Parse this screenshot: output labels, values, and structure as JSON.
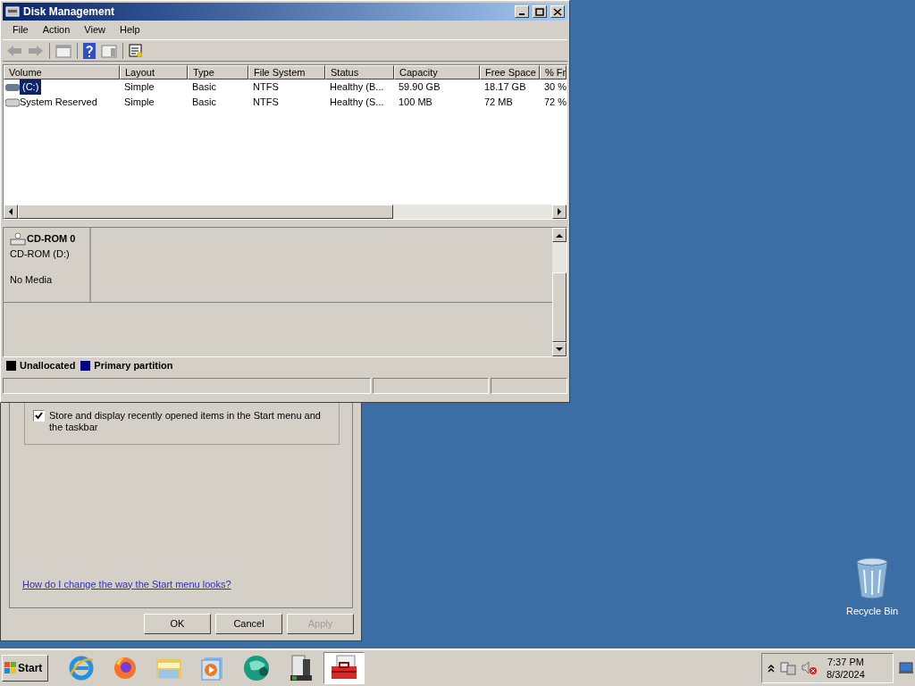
{
  "window": {
    "title": "Disk Management"
  },
  "menu": [
    "File",
    "Action",
    "View",
    "Help"
  ],
  "table": {
    "columns": [
      "Volume",
      "Layout",
      "Type",
      "File System",
      "Status",
      "Capacity",
      "Free Space",
      "% Fr"
    ],
    "rows": [
      {
        "kind": "disk",
        "selected": true,
        "cells": [
          "(C:)",
          "Simple",
          "Basic",
          "NTFS",
          "Healthy (B...",
          "59.90 GB",
          "18.17 GB",
          "30 %"
        ]
      },
      {
        "kind": "reserved",
        "selected": false,
        "cells": [
          "System Reserved",
          "Simple",
          "Basic",
          "NTFS",
          "Healthy (S...",
          "100 MB",
          "72 MB",
          "72 %"
        ]
      }
    ]
  },
  "disks": [
    {
      "name": "CD-ROM 0",
      "volume": "CD-ROM (D:)",
      "status": "No Media"
    }
  ],
  "legend": [
    {
      "label": "Unallocated",
      "color": "#000000"
    },
    {
      "label": "Primary partition",
      "color": "#000080"
    }
  ],
  "dialog": {
    "checkbox": {
      "label": "Store and display recently opened items in the Start menu and the taskbar",
      "checked": true
    },
    "link": "How do I change the way the Start menu looks?",
    "buttons": [
      {
        "label": "OK",
        "disabled": false
      },
      {
        "label": "Cancel",
        "disabled": false
      },
      {
        "label": "Apply",
        "disabled": true
      }
    ]
  },
  "desktop_icons": [
    {
      "label": "Recycle Bin"
    }
  ],
  "taskbar": {
    "start": "Start",
    "apps": [
      {
        "kind": "browser-e",
        "selected": false
      },
      {
        "kind": "browser-fox",
        "selected": false
      },
      {
        "kind": "folder",
        "selected": false
      },
      {
        "kind": "media",
        "selected": false
      },
      {
        "kind": "globe",
        "selected": false
      },
      {
        "kind": "server",
        "selected": false
      },
      {
        "kind": "toolbox",
        "selected": true
      }
    ],
    "time": "7:37 PM",
    "date": "8/3/2024"
  }
}
